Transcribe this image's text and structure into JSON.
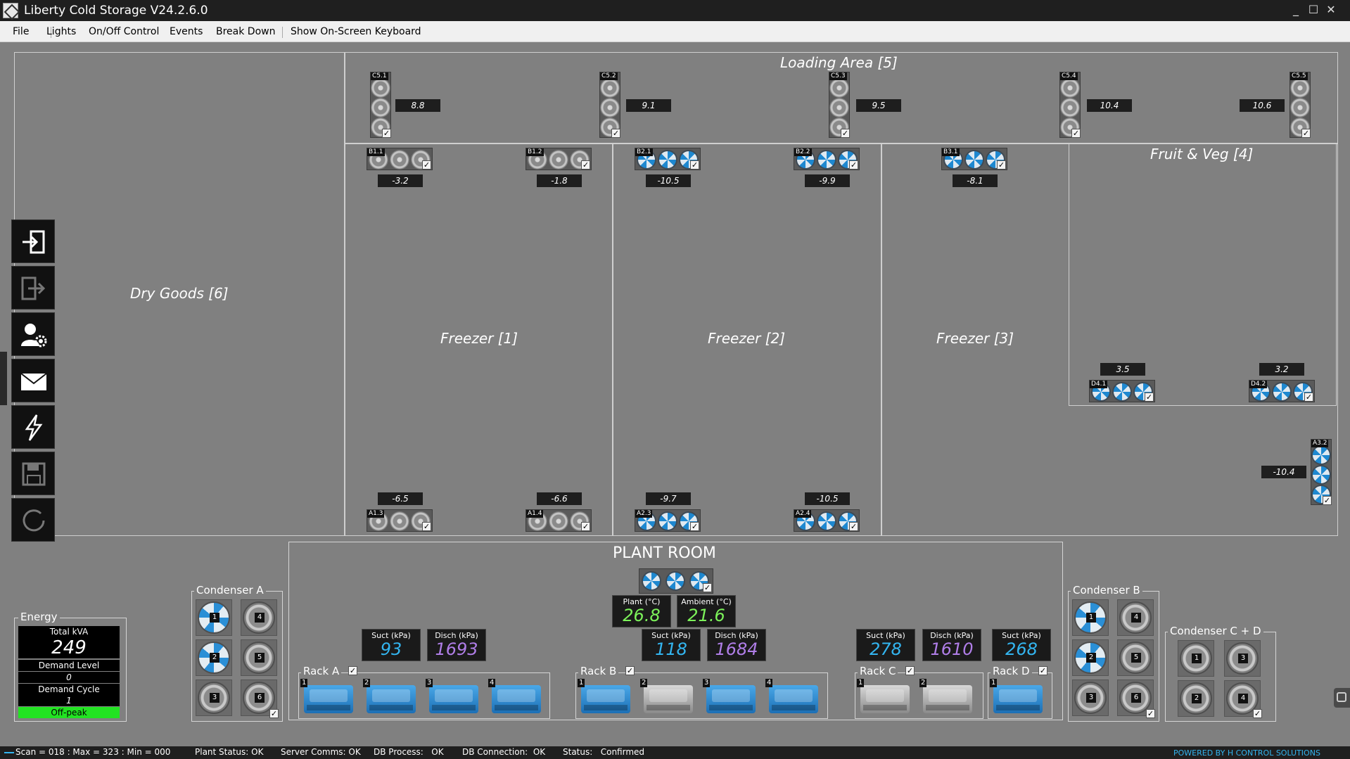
{
  "window": {
    "title": "Liberty Cold Storage V24.2.6.0",
    "controls": [
      "_",
      "☐",
      "✕"
    ]
  },
  "menu": [
    "File",
    "Lights",
    "On/Off Control",
    "Events",
    "Break Down",
    "Show On-Screen Keyboard"
  ],
  "zones": {
    "loading_area": "Loading Area [5]",
    "dry_goods": "Dry Goods [6]",
    "freezer1": "Freezer [1]",
    "freezer2": "Freezer [2]",
    "freezer3": "Freezer [3]",
    "fruit_veg": "Fruit & Veg [4]",
    "plant_room": "PLANT ROOM"
  },
  "units": {
    "C5.1": {
      "label": "C5.1",
      "temp": "8.8"
    },
    "C5.2": {
      "label": "C5.2",
      "temp": "9.1"
    },
    "C5.3": {
      "label": "C5.3",
      "temp": "9.5"
    },
    "C5.4": {
      "label": "C5.4",
      "temp": "10.4"
    },
    "C5.5": {
      "label": "C5.5",
      "temp": "10.6"
    },
    "B1.1": {
      "label": "B1.1",
      "temp": "-3.2"
    },
    "B1.2": {
      "label": "B1.2",
      "temp": "-1.8"
    },
    "B2.1": {
      "label": "B2.1",
      "temp": "-10.5"
    },
    "B2.2": {
      "label": "B2.2",
      "temp": "-9.9"
    },
    "B3.1": {
      "label": "B3.1",
      "temp": "-8.1"
    },
    "A1.3": {
      "label": "A1.3",
      "temp": "-6.5"
    },
    "A1.4": {
      "label": "A1.4",
      "temp": "-6.6"
    },
    "A2.3": {
      "label": "A2.3",
      "temp": "-9.7"
    },
    "A2.4": {
      "label": "A2.4",
      "temp": "-10.5"
    },
    "D4.1": {
      "label": "D4.1",
      "temp": "3.5"
    },
    "D4.2": {
      "label": "D4.2",
      "temp": "3.2"
    },
    "A3.2": {
      "label": "A3.2",
      "temp": "-10.4"
    }
  },
  "plant": {
    "plant_label": "Plant (°C)",
    "plant_value": "26.8",
    "ambient_label": "Ambient (°C)",
    "ambient_value": "21.6"
  },
  "racks": {
    "rackA": {
      "name": "Rack A",
      "suct_label": "Suct (kPa)",
      "suct": "93",
      "disch_label": "Disch (kPa)",
      "disch": "1693",
      "compressors": [
        "1",
        "2",
        "3",
        "4"
      ]
    },
    "rackB": {
      "name": "Rack B",
      "suct_label": "Suct (kPa)",
      "suct": "118",
      "disch_label": "Disch (kPa)",
      "disch": "1684",
      "compressors": [
        "1",
        "2",
        "3",
        "4"
      ]
    },
    "rackC": {
      "name": "Rack C",
      "suct_label": "Suct (kPa)",
      "suct": "278",
      "disch_label": "Disch (kPa)",
      "disch": "1610",
      "compressors": [
        "1",
        "2"
      ]
    },
    "rackD": {
      "name": "Rack D",
      "suct_label": "Suct (kPa)",
      "suct": "268",
      "compressors": [
        "1"
      ]
    }
  },
  "condensers": {
    "A": {
      "name": "Condenser A",
      "fans": [
        "1",
        "4",
        "2",
        "5",
        "3",
        "6"
      ]
    },
    "B": {
      "name": "Condenser B",
      "fans": [
        "1",
        "4",
        "2",
        "5",
        "3",
        "6"
      ]
    },
    "CD": {
      "name": "Condenser C + D",
      "fans": [
        "1",
        "3",
        "2",
        "4"
      ]
    }
  },
  "energy": {
    "title": "Energy",
    "kva_label": "Total kVA",
    "kva_value": "249",
    "demand_level_label": "Demand Level",
    "demand_level_value": "0",
    "demand_cycle_label": "Demand Cycle",
    "demand_cycle_value": "1",
    "tariff": "Off-peak"
  },
  "status": {
    "scan": "Scan = 018 : Max = 323 : Min = 000",
    "plant_status": "Plant Status: OK",
    "server_comms": "Server Comms: OK",
    "db_process": "DB Process:   OK",
    "db_connection": "DB Connection:  OK",
    "status": "Status:   Confirmed",
    "powered_by": "POWERED BY H CONTROL SOLUTIONS"
  },
  "colors": {
    "suct_value": "#33b5f0",
    "disch_value": "#b07ee8",
    "plant_value": "#7cf25a",
    "off_peak": "#22e322"
  }
}
